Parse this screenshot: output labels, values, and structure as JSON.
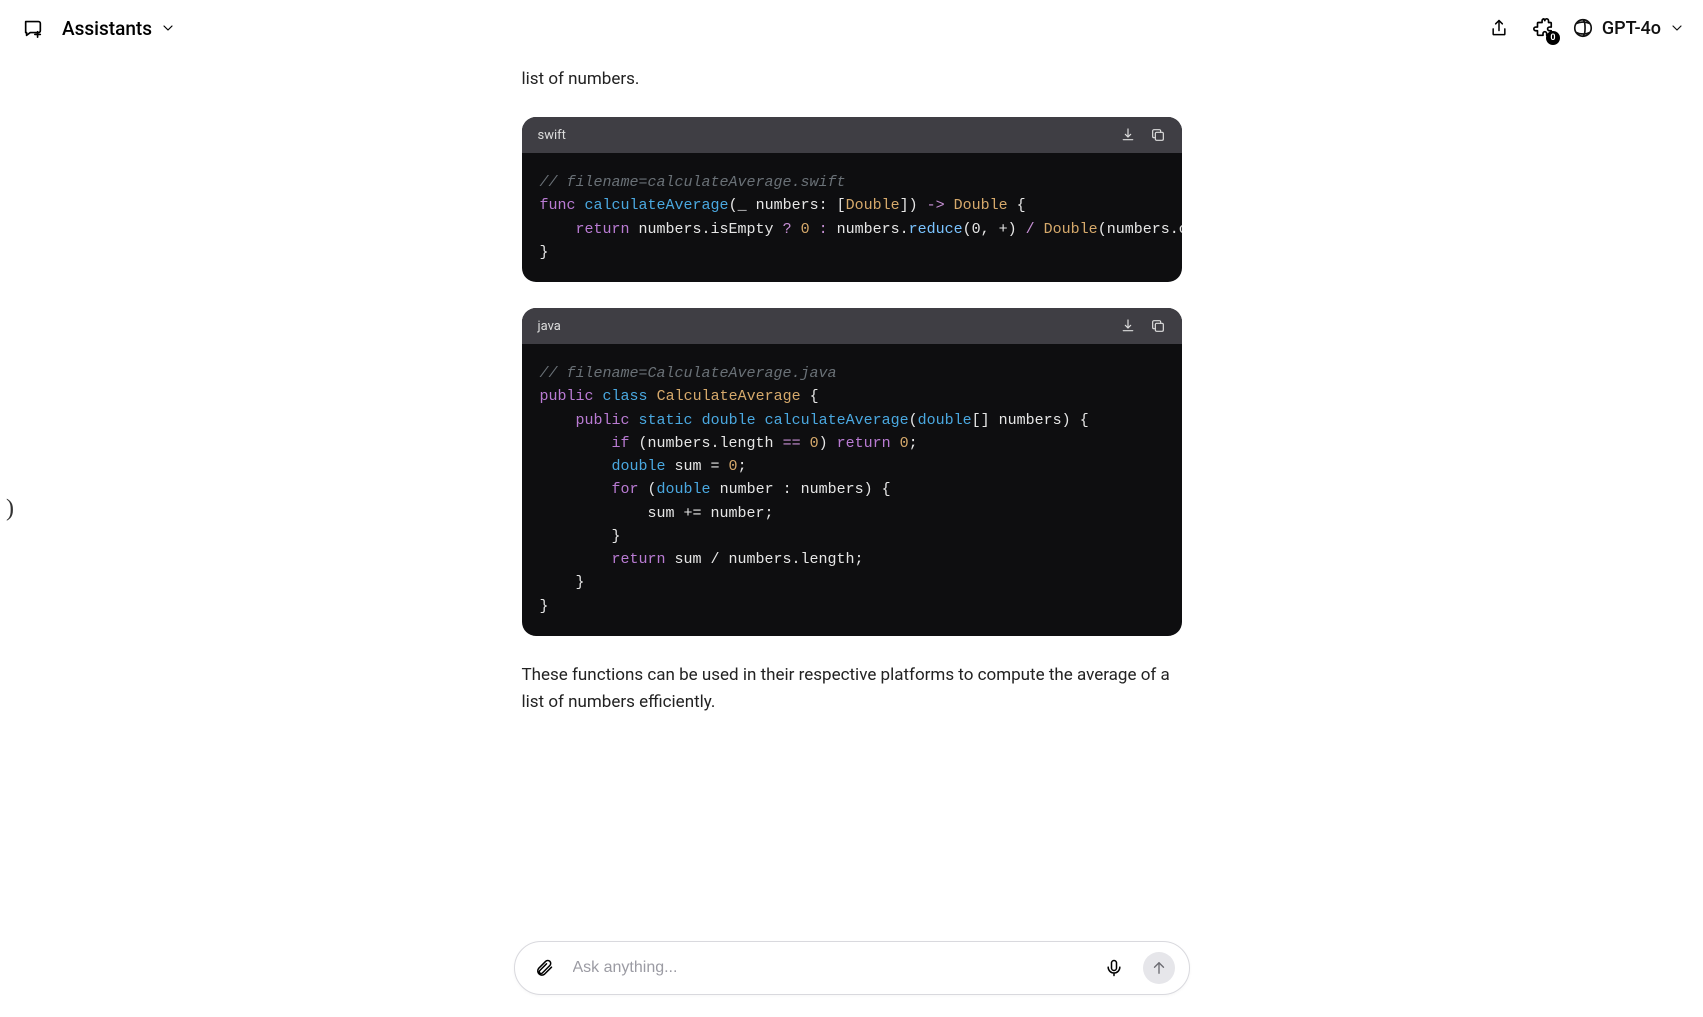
{
  "header": {
    "title": "Assistants",
    "model": "GPT-4o",
    "puzzle_badge": "0"
  },
  "conversation": {
    "intro_trail": "list of numbers.",
    "code1": {
      "lang": "swift",
      "comment": "// filename=calculateAverage.swift",
      "line2_func": "func",
      "line2_name": "calculateAverage",
      "line2_sig1": "(_ numbers: [",
      "line2_type": "Double",
      "line2_sig2": "]) ",
      "line2_arrow": "->",
      "line2_ret": " Double",
      "line2_brace": " {",
      "line3_ret": "return",
      "line3_body1": " numbers.isEmpty ",
      "line3_q": "?",
      "line3_zero": " 0 ",
      "line3_colon": ":",
      "line3_body2": " numbers.",
      "line3_reduce": "reduce",
      "line3_args": "(0, +) ",
      "line3_div": "/",
      "line3_cast": " Double",
      "line3_end": "(numbers.count)",
      "line4": "}"
    },
    "code2": {
      "lang": "java",
      "comment": "// filename=CalculateAverage.java",
      "l2_public": "public",
      "l2_class": "class",
      "l2_name": "CalculateAverage",
      "l2_brace": " {",
      "l3_public": "public",
      "l3_static": "static",
      "l3_double": "double",
      "l3_fn": "calculateAverage",
      "l3_open": "(",
      "l3_argtype": "double",
      "l3_rest": "[] numbers) {",
      "l4_if": "if",
      "l4_cond": " (numbers.length ",
      "l4_eq": "==",
      "l4_zero": " 0",
      "l4_paren": ") ",
      "l4_ret": "return",
      "l4_val": " 0",
      "l4_semi": ";",
      "l5_type": "double",
      "l5_rest": " sum = ",
      "l5_zero": "0",
      "l5_semi": ";",
      "l6_for": "for",
      "l6_open": " (",
      "l6_type": "double",
      "l6_rest": " number : numbers) {",
      "l7": "            sum += number;",
      "l8": "        }",
      "l9_ret": "return",
      "l9_body": " sum / numbers.length;",
      "l10": "    }",
      "l11": "}"
    },
    "outro": "These functions can be used in their respective platforms to compute the average of a list of numbers efficiently."
  },
  "composer": {
    "placeholder": "Ask anything..."
  },
  "left_handle": ")"
}
